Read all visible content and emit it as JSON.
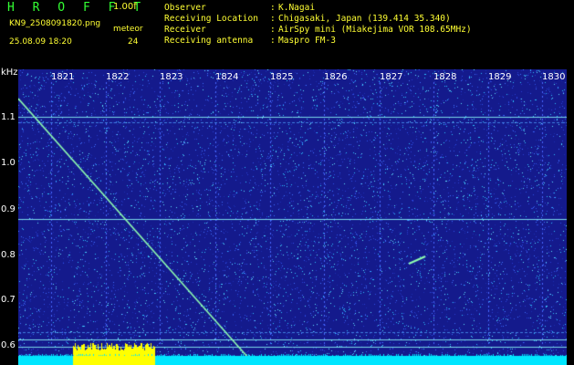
{
  "header": {
    "logo": "H R O F F T",
    "version": "1.00f",
    "file_name": "KN9_2508091820.png",
    "timestamp": "25.08.09 18:20",
    "meteor_label": "meteor",
    "meteor_count": "24"
  },
  "info": [
    {
      "key": "Observer",
      "value": "K.Nagai"
    },
    {
      "key": "Receiving Location",
      "value": "Chigasaki, Japan (139.414 35.340)"
    },
    {
      "key": "Receiver",
      "value": "AirSpy mini (Miakejima VOR 108.65MHz)"
    },
    {
      "key": "Receiving antenna",
      "value": "Maspro FM-3"
    }
  ],
  "info_separator": ":",
  "axes": {
    "y_unit": "kHz",
    "y_ticks": [
      "1.1",
      "1.0",
      "0.9",
      "0.8",
      "0.7",
      "0.6"
    ],
    "x_ticks": [
      "1821",
      "1822",
      "1823",
      "1824",
      "1825",
      "1826",
      "1827",
      "1828",
      "1829",
      "1830"
    ]
  },
  "colors": {
    "background": "#000000",
    "label_green": "#33ff33",
    "label_yellow": "#ffff33",
    "waterfall_bg": "#141a8c",
    "signal_line": "#90ffb0",
    "bottom_band": "#00e6ff",
    "spike_block": "#ffff00"
  }
}
